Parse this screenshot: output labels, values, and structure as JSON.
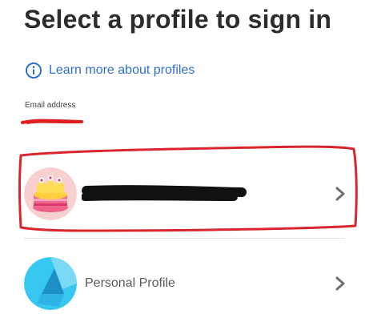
{
  "page": {
    "title": "Select a profile to sign in"
  },
  "info_link": {
    "icon": "info-icon",
    "label": "Learn more about profiles",
    "color": "#2f6fcf"
  },
  "email": {
    "label": "Email address",
    "value": "",
    "redacted": true
  },
  "profiles": [
    {
      "name": "",
      "redacted": true,
      "avatar": "cake-avatar",
      "chevron_icon": "chevron-right-icon",
      "selected_highlight_color": "#d9262e"
    },
    {
      "name": "Personal Profile",
      "avatar": "personal-profile-avatar",
      "chevron_icon": "chevron-right-icon",
      "avatar_colors": [
        "#36c8f0",
        "#1c8fc6"
      ]
    }
  ]
}
